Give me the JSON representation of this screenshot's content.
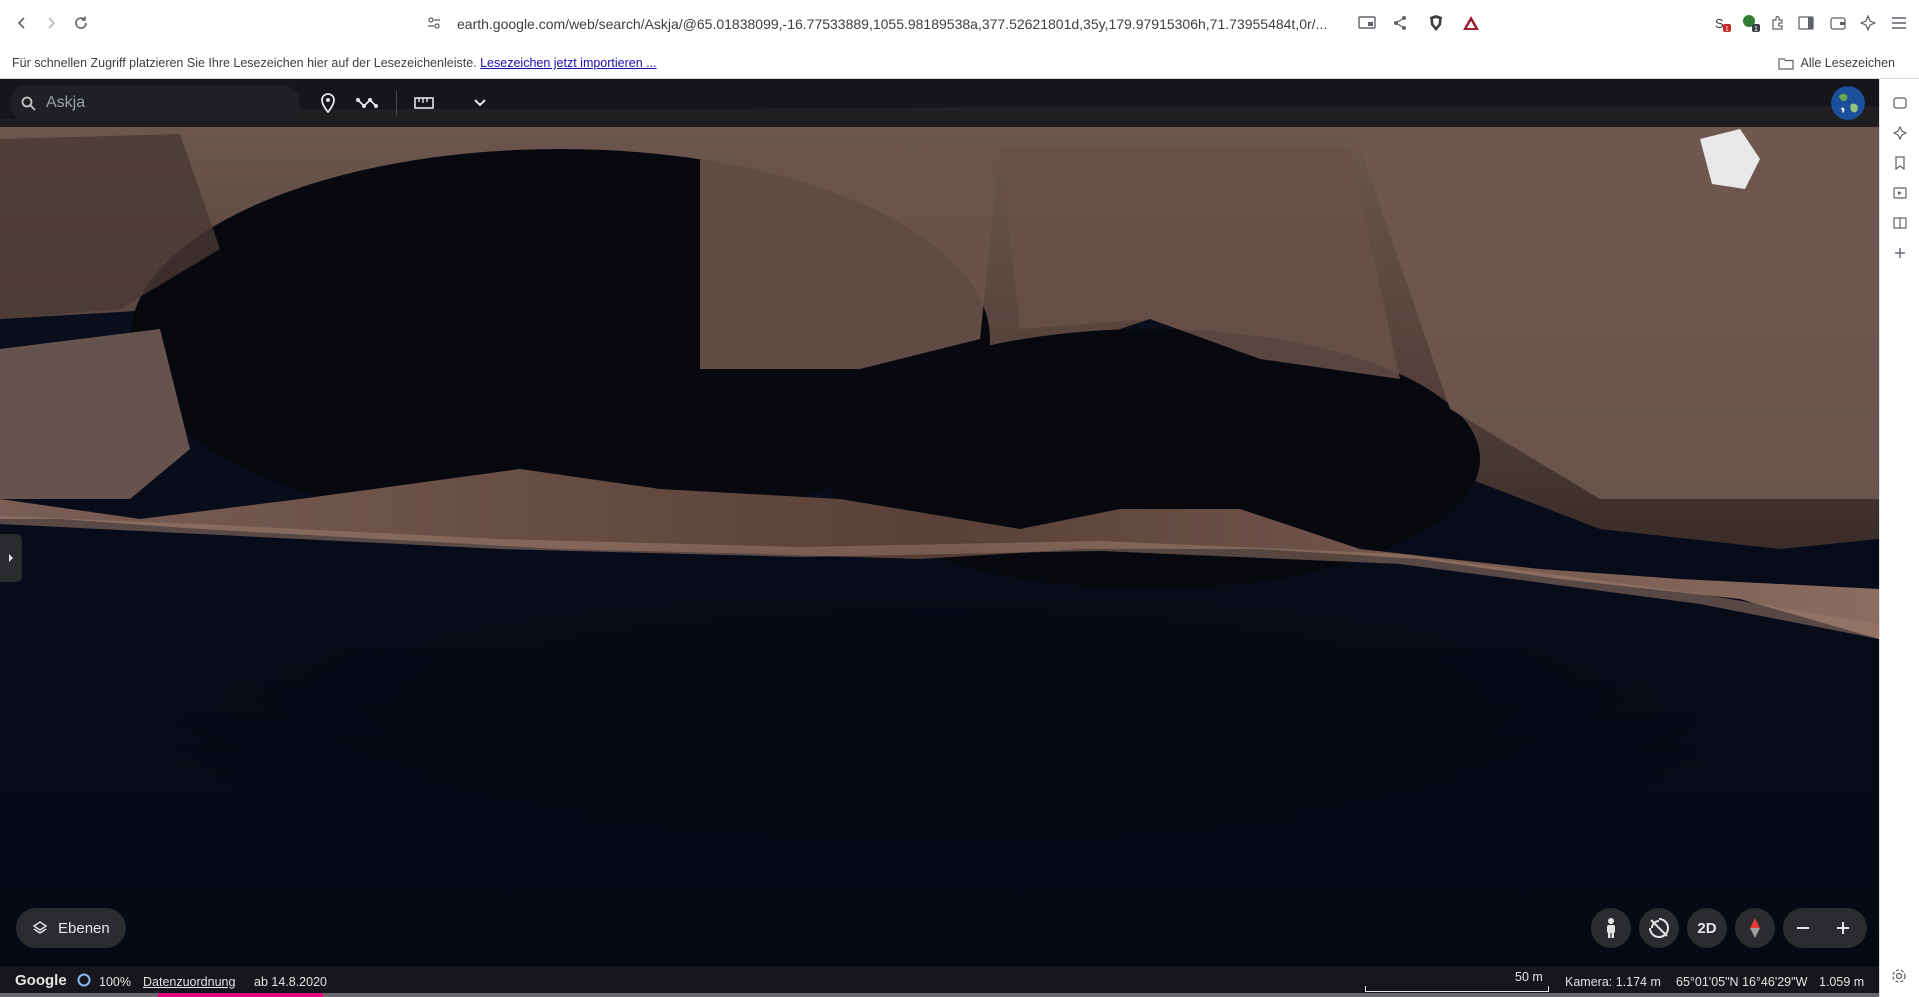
{
  "browser": {
    "url": "earth.google.com/web/search/Askja/@65.01838099,-16.77533889,1055.98189538a,377.52621801d,35y,179.97915306h,71.73955484t,0r/...",
    "extension_badges": [
      "1",
      "1"
    ],
    "bookmarks_bar": {
      "message": "Für schnellen Zugriff platzieren Sie Ihre Lesezeichen hier auf der Lesezeichenleiste.",
      "import_link": "Lesezeichen jetzt importieren ...",
      "all_bookmarks": "Alle Lesezeichen"
    }
  },
  "earth": {
    "search_placeholder": "Askja",
    "layers_label": "Ebenen",
    "view_2d_label": "2D",
    "bottom": {
      "logo": "Google",
      "load_percent": "100%",
      "data_attribution": "Datenzuordnung",
      "imagery_date": "ab 14.8.2020",
      "scale": "50 m",
      "camera": "Kamera: 1.174 m",
      "coordinates": "65°01'05\"N 16°46'29\"W",
      "elevation": "1.059 m"
    }
  },
  "colors": {
    "toolbar_bg": "#ffffff",
    "earth_bar_bg": "#16171a",
    "accent_link": "#1a0dab",
    "compass_red": "#e53935"
  },
  "icons": [
    "back-icon",
    "forward-icon",
    "reload-icon",
    "bookmark-icon",
    "site-settings-icon",
    "cast-icon",
    "share-icon",
    "brave-shield-icon",
    "brave-rewards-icon",
    "extension-icon",
    "sidebar-icon",
    "wallet-icon",
    "leo-icon",
    "menu-icon",
    "search-icon",
    "placemark-icon",
    "path-icon",
    "ruler-icon",
    "chevron-down-icon",
    "globe-icon",
    "layers-icon",
    "pegman-icon",
    "tilt-icon",
    "compass-icon",
    "zoom-out-icon",
    "zoom-in-icon",
    "settings-icon"
  ]
}
